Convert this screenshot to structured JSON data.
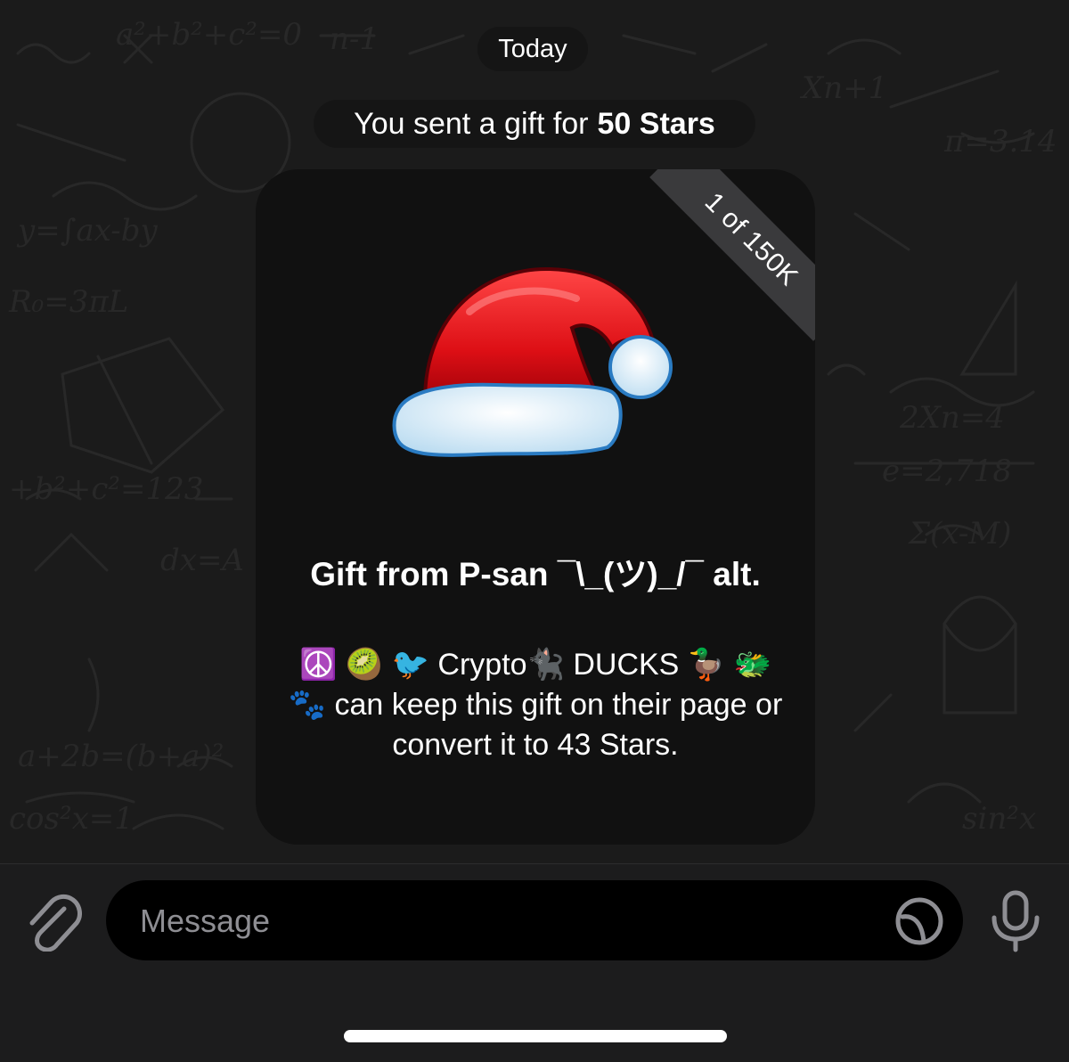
{
  "chat": {
    "date_label": "Today",
    "service_message": {
      "prefix": "You sent a gift for",
      "amount": "50 Stars"
    }
  },
  "gift": {
    "ribbon": "1 of 150K",
    "title": "Gift from P-san ¯\\_(ツ)_/¯ alt.",
    "description": "☮️ 🥝 🐦 Crypto🐈‍⬛ DUCKS 🦆 🐲 🐾 can keep this gift on their page or convert it to 43 Stars.",
    "icon": "santa-hat"
  },
  "composer": {
    "placeholder": "Message",
    "attach_icon": "paperclip-icon",
    "sticker_icon": "sticker-icon",
    "mic_icon": "microphone-icon"
  },
  "colors": {
    "background": "#1b1b1b",
    "card": "#111111",
    "ribbon": "#3a3a3c",
    "hat_red": "#e0141c",
    "fur": "#eef6fc"
  }
}
